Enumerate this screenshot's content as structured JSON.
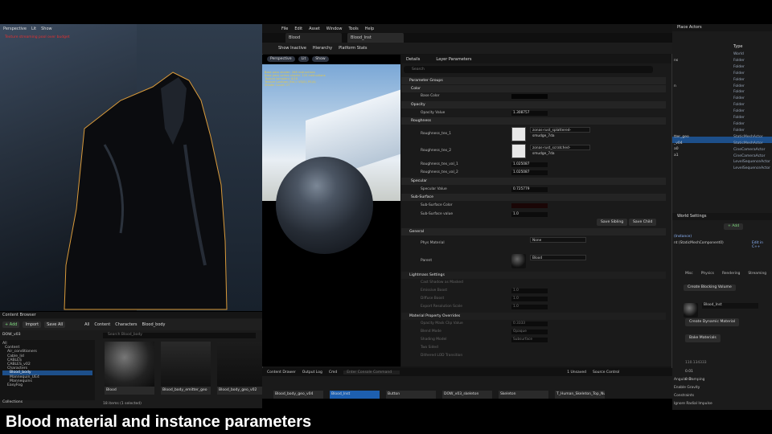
{
  "left_viewport": {
    "toolbar": [
      "Perspective",
      "Lit",
      "Show"
    ],
    "red_text": "Texture streaming pool over budget"
  },
  "content_browser": {
    "title": "Content Browser",
    "add": "Add",
    "import": "Import",
    "save_all": "Save All",
    "path": [
      "All",
      "Content",
      "Characters",
      "Blood_body"
    ],
    "search_placeholder": "Search Blood_body",
    "project": "DOW_v03",
    "tree": [
      "All",
      "Content",
      "Air_conditioners",
      "Cable_lid",
      "CABLES",
      "CABLES_v02",
      "Characters",
      "Blood_body",
      "Mannequin_UE4",
      "Mannequins",
      "EasyFog"
    ],
    "assets": [
      "Blood",
      "Blood_body_emitter_geo",
      "Blood_body_geo_v02",
      "Blood_body_geo_v04",
      "Blood_Inst",
      "Button",
      "DOW_v03_skeleton",
      "Skeleton",
      "T_Human_Skeleton_Top_Num1_Morph_e"
    ],
    "status": "18 items (1 selected)",
    "collections": "Collections"
  },
  "material_editor": {
    "menu": [
      "File",
      "Edit",
      "Asset",
      "Window",
      "Tools",
      "Help"
    ],
    "tabs": [
      "Blood",
      "Blood_Inst"
    ],
    "toolbar": [
      "Show Inactive",
      "Hierarchy",
      "Platform Stats"
    ],
    "viewport_toolbar": [
      "Perspective",
      "Lit",
      "Show"
    ],
    "stats": "Base pass shader: 268 instructions\nBase pass vertex shader: 125 instructions\nTexture samplers: 8/16\nTexture Lookups (Est.): VS(0), PS(4)\nShader Count: 27",
    "details_tabs": [
      "Details",
      "Layer Parameters"
    ],
    "search": "Search",
    "groups": {
      "parameter_groups": "Parameter Groups",
      "color": "Color",
      "base_color": "Base Color",
      "opacity": "Opacity",
      "opacity_value": "Opacity Value",
      "opacity_num": "1.308757",
      "roughness": "Roughness",
      "rough_tex1": "Roughness_tex_1",
      "rough_tex1_asset": "zonas-rust_splattered-smudge_7da",
      "rough_tex2": "Roughness_tex_2",
      "rough_tex2_asset": "zonas-rust_scratched-smudge_7da",
      "rough_val1": "Roughness_tex_val_1",
      "rough_val1_num": "1.025087",
      "rough_val2": "Roughness_tex_val_2",
      "rough_val2_num": "1.025087",
      "specular": "Specular",
      "specular_value": "Specular Value",
      "specular_num": "0.725779",
      "subsurface": "Sub-Surface",
      "subsurface_color": "Sub-Surface Color",
      "subsurface_value": "Sub-Surface value",
      "subsurface_num": "1.0",
      "save_sibling": "Save Sibling",
      "save_child": "Save Child",
      "general": "General",
      "phys_material": "Phys Material",
      "phys_none": "None",
      "parent": "Parent",
      "parent_value": "Blood",
      "lightmass": "Lightmass Settings",
      "lm_rows": [
        "Cast Shadow as Masked",
        "Emissive Boost",
        "Diffuse Boost",
        "Export Resolution Scale"
      ],
      "lm_vals": [
        "",
        "1.0",
        "1.0",
        "1.0"
      ],
      "overrides": "Material Property Overrides",
      "ov_rows": [
        "Opacity Mask Clip Value",
        "Blend Mode",
        "Shading Model",
        "Two Sided",
        "Dithered LOD Transition"
      ],
      "ov_vals": [
        "0.3333",
        "Opaque",
        "Subsurface",
        "",
        ""
      ]
    },
    "bottombar": [
      "Content Drawer",
      "Output Log",
      "Cmd",
      "Enter Console Command",
      "1 Unsaved",
      "Source Control"
    ]
  },
  "outliner": {
    "title": "Place Actors",
    "type_header": "Type",
    "types": [
      "World",
      "Folder",
      "Folder",
      "Folder",
      "Folder",
      "Folder",
      "Folder",
      "Folder",
      "Folder",
      "Folder",
      "Folder",
      "Folder",
      "Folder",
      "StaticMeshActor",
      "StaticMeshActor",
      "CineCameraActor",
      "CineCameraActor",
      "LevelSequenceActor",
      "LevelSequenceActor"
    ],
    "names": [
      "ns",
      "",
      "",
      "",
      "n",
      "",
      "",
      "",
      "",
      "",
      "",
      "",
      "tter_geo",
      "_v04",
      "a0",
      "a1",
      ""
    ],
    "world_settings": "World Settings",
    "add": "Add",
    "instance": "(Instance)",
    "component": "nt (StaticMeshComponent0)",
    "edit_cpp": "Edit in C++",
    "filter_tabs": [
      "Misc",
      "Physics",
      "Rendering",
      "Streaming"
    ],
    "blocking_volume": "Create Blocking Volume",
    "material_name": "Blood_Inst",
    "create_dynamic": "Create Dynamic Material",
    "bake": "Bake Materials",
    "props": [
      "Angular Damping",
      "Enable Gravity",
      "Constraints",
      "Ignore Radial Impulse"
    ],
    "prop_vals": [
      "0.01",
      "0.0",
      "",
      ""
    ],
    "numbers": [
      "110.134333",
      "0.01",
      "0.0"
    ]
  },
  "caption": "Blood material and instance parameters"
}
